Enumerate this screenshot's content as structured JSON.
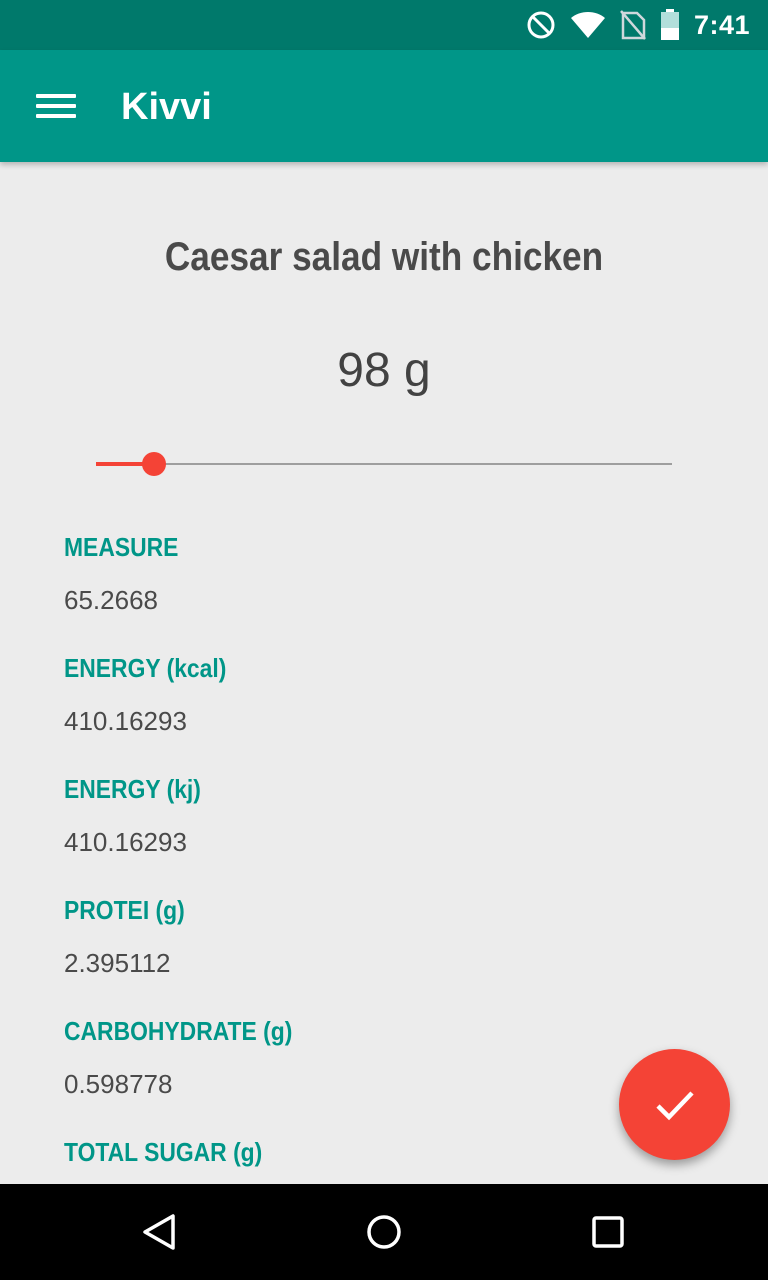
{
  "status_bar": {
    "time": "7:41",
    "icons": [
      "do-not-disturb-icon",
      "wifi-icon",
      "no-sim-icon",
      "battery-icon"
    ]
  },
  "app_bar": {
    "title": "Kivvi",
    "menu_icon": "hamburger-menu-icon"
  },
  "food": {
    "name": "Caesar salad with chicken",
    "portion_label": "98 g",
    "slider_fraction": 0.1
  },
  "nutrients": [
    {
      "label": "MEASURE",
      "value": "65.2668"
    },
    {
      "label": "ENERGY (kcal)",
      "value": "410.16293"
    },
    {
      "label": "ENERGY (kj)",
      "value": "410.16293"
    },
    {
      "label": "PROTEI (g)",
      "value": "2.395112"
    },
    {
      "label": "CARBOHYDRATE (g)",
      "value": "0.598778"
    },
    {
      "label": "TOTAL SUGAR (g)",
      "value": ""
    }
  ],
  "fab": {
    "icon": "check-icon"
  },
  "nav_bar": {
    "icons": [
      "back-icon",
      "home-icon",
      "recents-icon"
    ]
  },
  "colors": {
    "status_bar": "#00796b",
    "primary": "#009688",
    "accent": "#f44336",
    "background": "#ececec",
    "text": "#4a4a4a"
  }
}
